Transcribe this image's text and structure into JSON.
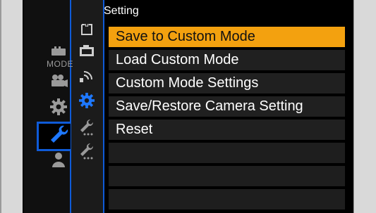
{
  "title": "Setting",
  "left_tabs": [
    {
      "name": "mode-icon",
      "label": "MODE",
      "active": false
    },
    {
      "name": "video-camera-icon",
      "active": false
    },
    {
      "name": "gear-icon",
      "active": false
    },
    {
      "name": "wrench-icon",
      "active": true
    },
    {
      "name": "person-icon",
      "active": false
    }
  ],
  "sub_tabs": [
    {
      "name": "custom-bracket-icon"
    },
    {
      "name": "card-icon"
    },
    {
      "name": "signal-icon"
    },
    {
      "name": "gear-icon-active"
    },
    {
      "name": "wrench-dots-icon"
    },
    {
      "name": "wrench-dots-icon"
    }
  ],
  "menu_items": [
    {
      "label": "Save to Custom Mode",
      "selected": true
    },
    {
      "label": "Load Custom Mode",
      "selected": false
    },
    {
      "label": "Custom Mode Settings",
      "selected": false
    },
    {
      "label": "Save/Restore Camera Setting",
      "selected": false
    },
    {
      "label": "Reset",
      "selected": false
    },
    {
      "label": "",
      "selected": false
    },
    {
      "label": "",
      "selected": false
    },
    {
      "label": "",
      "selected": false
    }
  ],
  "colors": {
    "selected": "#f3a10f",
    "accent_blue": "#0f5bd8"
  }
}
